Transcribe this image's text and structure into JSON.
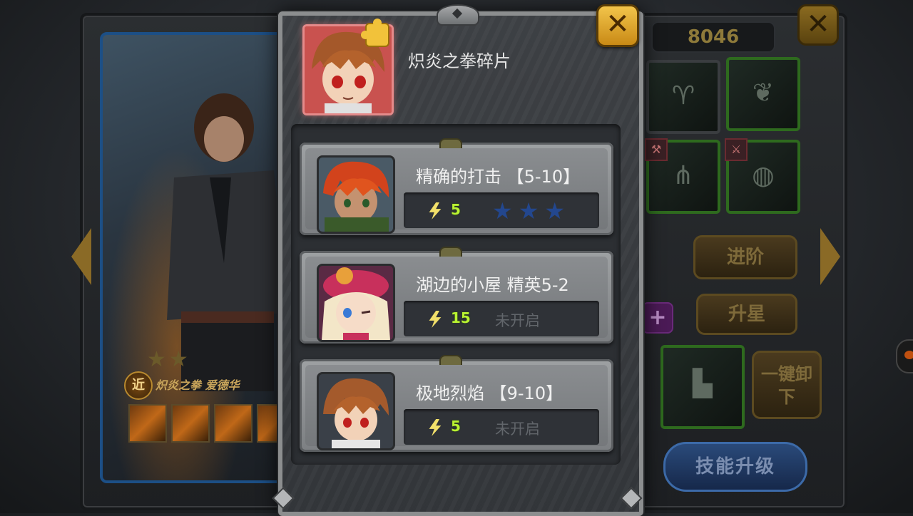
{
  "background": {
    "gold": "8046",
    "hero": {
      "type_badge": "近",
      "name": "炽炎之拳 爱德华",
      "stars": "★★"
    },
    "buttons": {
      "advance": "进阶",
      "star_up": "升星",
      "unequip_all": "一键卸下",
      "skill_upgrade": "技能升级",
      "plus": "+"
    }
  },
  "popup": {
    "item": {
      "title": "炽炎之拳碎片",
      "icon": "puzzle-fragment-icon"
    },
    "close_icon": "close-icon",
    "stages": [
      {
        "name": "精确的打击 【5-10】",
        "energy": "5",
        "stars": "★★★",
        "locked": false,
        "status": ""
      },
      {
        "name": "湖边的小屋  精英5-2",
        "energy": "15",
        "stars": "",
        "locked": true,
        "status": "未开启"
      },
      {
        "name": "极地烈焰 【9-10】",
        "energy": "5",
        "stars": "",
        "locked": true,
        "status": "未开启"
      }
    ]
  },
  "colors": {
    "close_button": "#f2c44a",
    "energy_text": "#b9f231",
    "star_color": "#23478e",
    "item_frame": "#e48a8a"
  }
}
